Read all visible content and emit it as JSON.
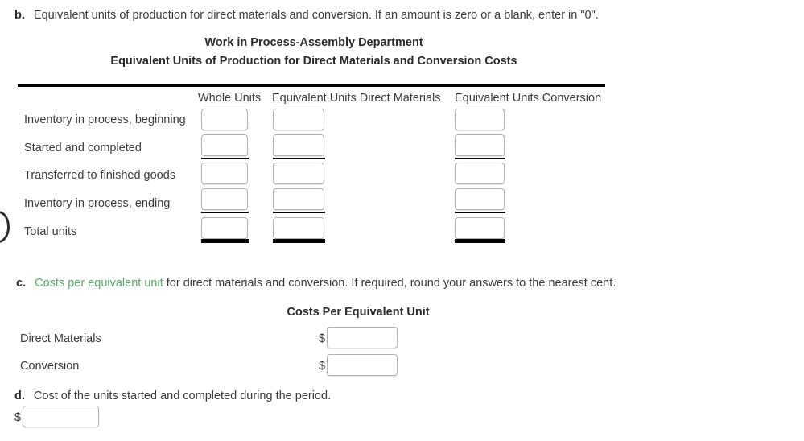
{
  "part_b": {
    "letter": "b.",
    "prompt": "Equivalent units of production for direct materials and conversion. If an amount is zero or a blank, enter in \"0\"."
  },
  "statement": {
    "title_line1": "Work in Process-Assembly Department",
    "title_line2": "Equivalent Units of Production for Direct Materials and Conversion Costs",
    "columns": [
      "Whole Units",
      "Equivalent Units Direct Materials",
      "Equivalent Units Conversion"
    ],
    "rows": [
      {
        "label": "Inventory in process, beginning",
        "whole_units": "",
        "eu_direct_materials": "",
        "eu_conversion": ""
      },
      {
        "label": "Started and completed",
        "whole_units": "",
        "eu_direct_materials": "",
        "eu_conversion": ""
      },
      {
        "label": "Transferred to finished goods",
        "whole_units": "",
        "eu_direct_materials": "",
        "eu_conversion": ""
      },
      {
        "label": "Inventory in process, ending",
        "whole_units": "",
        "eu_direct_materials": "",
        "eu_conversion": ""
      },
      {
        "label": "Total units",
        "whole_units": "",
        "eu_direct_materials": "",
        "eu_conversion": ""
      }
    ]
  },
  "part_c": {
    "letter": "c.",
    "term": "Costs per equivalent unit",
    "prompt_rest": " for direct materials and conversion. If required, round your answers to the nearest cent.",
    "term_color": "#5aa96a",
    "table_title": "Costs Per Equivalent Unit",
    "rows": [
      {
        "label": "Direct Materials",
        "currency": "$",
        "value": ""
      },
      {
        "label": "Conversion",
        "currency": "$",
        "value": ""
      }
    ]
  },
  "part_d": {
    "letter": "d.",
    "prompt": "Cost of the units started and completed during the period.",
    "currency": "$",
    "value": ""
  }
}
